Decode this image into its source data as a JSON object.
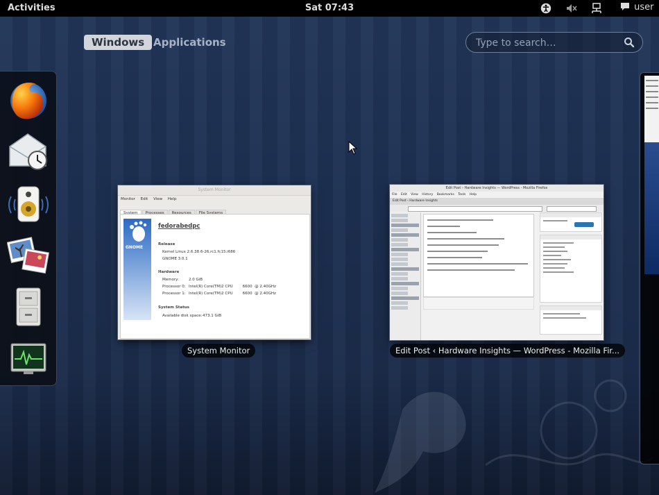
{
  "topbar": {
    "activities": "Activities",
    "clock": "Sat 07:43",
    "user": "user"
  },
  "tray": [
    "accessibility-icon",
    "volume-muted-icon",
    "network-icon",
    "chat-icon"
  ],
  "view_tabs": {
    "windows": "Windows",
    "applications": "Applications",
    "active": "Windows"
  },
  "search": {
    "placeholder": "Type to search…"
  },
  "dash": {
    "items": [
      "firefox-icon",
      "evolution-mail-icon",
      "rhythmbox-icon",
      "shotwell-photos-icon",
      "file-cabinet-icon",
      "system-monitor-icon"
    ]
  },
  "windows": [
    {
      "caption": "System Monitor",
      "content": {
        "titlebar": "System Monitor",
        "menu": [
          "Monitor",
          "Edit",
          "View",
          "Help"
        ],
        "tabs": [
          "System",
          "Processes",
          "Resources",
          "File Systems"
        ],
        "hostname": "fedorabedpc",
        "release_heading": "Release",
        "kernel": "Kernel Linux 2.6.38.6-26.rc1.fc15.i686",
        "gnome": "GNOME 3.0.1",
        "hardware_heading": "Hardware",
        "memory_label": "Memory:",
        "memory_value": "2.0 GiB",
        "cpu0_label": "Processor 0:",
        "cpu0_value": "Intel(R) Core(TM)2 CPU        6600  @ 2.40GHz",
        "cpu1_label": "Processor 1:",
        "cpu1_value": "Intel(R) Core(TM)2 CPU        6600  @ 2.40GHz",
        "status_heading": "System Status",
        "disk_label": "Available disk space:",
        "disk_value": "473.1 GiB",
        "logo_text": "GNOME"
      }
    },
    {
      "caption": "Edit Post ‹ Hardware Insights — WordPress - Mozilla Fir...",
      "content": {
        "titlebar": "Edit Post › Hardware Insights — WordPress - Mozilla Firefox",
        "menu": [
          "File",
          "Edit",
          "View",
          "History",
          "Bookmarks",
          "Tools",
          "Help"
        ],
        "tab": "Edit Post ‹ Hardware Insights"
      }
    }
  ],
  "colors": {
    "panel": "#000000",
    "background": "#1d3052",
    "active_tab": "#d2d6dc"
  }
}
